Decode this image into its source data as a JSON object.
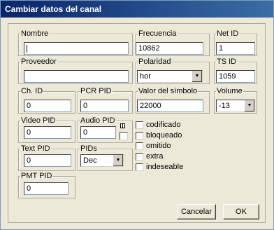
{
  "window": {
    "title": "Cambiar datos del canal"
  },
  "fields": {
    "nombre": {
      "label": "Nombre",
      "value": ""
    },
    "frecuencia": {
      "label": "Frecuencia",
      "value": "10862"
    },
    "net_id": {
      "label": "Net ID",
      "value": "1"
    },
    "proveedor": {
      "label": "Proveedor",
      "value": ""
    },
    "polaridad": {
      "label": "Polaridad",
      "value": "hor"
    },
    "ts_id": {
      "label": "TS ID",
      "value": "1059"
    },
    "ch_id": {
      "label": "Ch. ID",
      "value": "0"
    },
    "pcr_pid": {
      "label": "PCR PID",
      "value": "0"
    },
    "valor_simbolo": {
      "label": "Valor del símbolo",
      "value": "22000"
    },
    "volume": {
      "label": "Volume",
      "value": "-13"
    },
    "video_pid": {
      "label": "Video PID",
      "value": "0"
    },
    "audio_pid": {
      "label": "Audio PID",
      "value": "0"
    },
    "text_pid": {
      "label": "Text PID",
      "value": "0"
    },
    "pids": {
      "label": "PIDs",
      "value": "Dec"
    },
    "pmt_pid": {
      "label": "PMT PID",
      "value": "0"
    }
  },
  "checkboxes": [
    {
      "label": "codificado",
      "checked": false
    },
    {
      "label": "bloqueado",
      "checked": false
    },
    {
      "label": "omitido",
      "checked": false
    },
    {
      "label": "extra",
      "checked": false
    },
    {
      "label": "indeseable",
      "checked": false
    }
  ],
  "buttons": {
    "cancel": "Cancelar",
    "ok": "OK"
  }
}
